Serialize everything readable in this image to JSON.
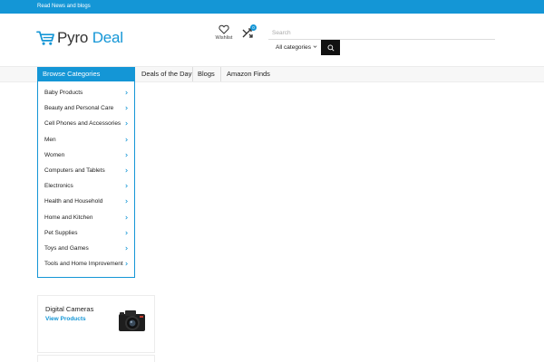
{
  "topbar": {
    "text": "Read News and blogs"
  },
  "brand": {
    "name_part1": "Pyro",
    "name_part2": "Deal",
    "accent_color": "#1496d6"
  },
  "header": {
    "wishlist_label": "Wishlist",
    "compare_count": "0",
    "search_placeholder": "Search",
    "category_select": "All categories",
    "icons": [
      "cart-icon",
      "heart-icon",
      "compare-icon",
      "search-icon"
    ]
  },
  "nav": {
    "browse_label": "Browse Categories",
    "items": [
      "Deals of the Day",
      "Blogs",
      "Amazon Finds"
    ]
  },
  "categories": [
    "Baby Products",
    "Beauty and Personal Care",
    "Cell Phones and Accessories",
    "Men",
    "Women",
    "Computers and Tablets",
    "Electronics",
    "Health and Household",
    "Home and Kitchen",
    "Pet Supplies",
    "Toys and Games",
    "Tools and Home Improvement"
  ],
  "product_card": {
    "title": "Digital Cameras",
    "link": "View Products"
  }
}
